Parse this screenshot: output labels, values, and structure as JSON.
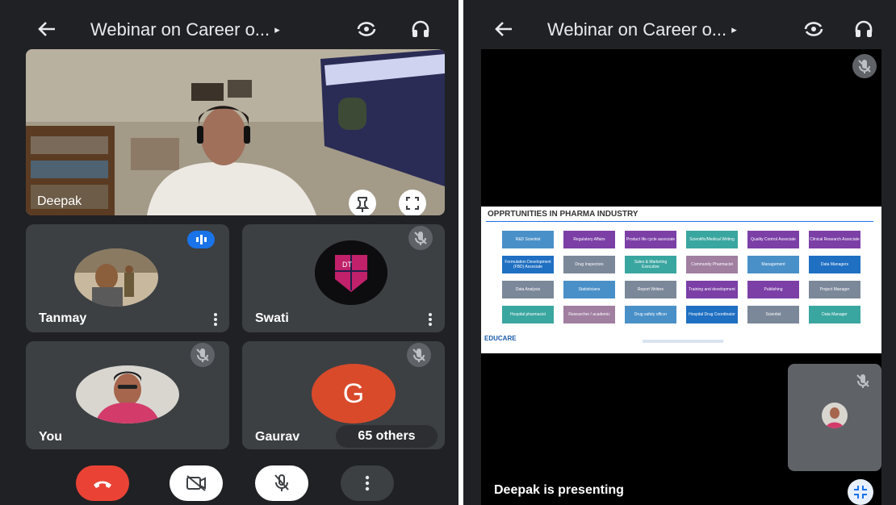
{
  "left": {
    "header": {
      "title": "Webinar on Career o...",
      "arrow": "▸"
    },
    "main_speaker": {
      "name": "Deepak"
    },
    "tiles": [
      {
        "name": "Tanmay"
      },
      {
        "name": "Swati"
      },
      {
        "name": "You"
      },
      {
        "name": "Gaurav",
        "initial": "G",
        "others_label": "65 others"
      }
    ],
    "logo_text": "DT",
    "colors": {
      "end_call": "#ea4335",
      "gaurav_avatar": "#d94a2b",
      "speaking": "#1a73e8"
    }
  },
  "right": {
    "header": {
      "title": "Webinar on Career o...",
      "arrow": "▸"
    },
    "slide": {
      "heading": "OPPRTUNITIES IN PHARMA INDUSTRY",
      "brand": "EDUCARE",
      "cells": [
        {
          "label": "R&D Scientist",
          "color": "#4a90c8"
        },
        {
          "label": "Regulatory Affairs",
          "color": "#7b3fa6"
        },
        {
          "label": "Product life cycle associate",
          "color": "#7b3fa6"
        },
        {
          "label": "Scientific/Medical Writing",
          "color": "#3aa6a0"
        },
        {
          "label": "Quality Control Associate",
          "color": "#7b3fa6"
        },
        {
          "label": "Clinical Research Associate",
          "color": "#7b3fa6"
        },
        {
          "label": "Formulation Development (FBD) Associate",
          "color": "#1f6fc2"
        },
        {
          "label": "Drug Inspectors",
          "color": "#7b8899"
        },
        {
          "label": "Sales & Marketing Executive",
          "color": "#3aa6a0"
        },
        {
          "label": "Community Pharmacist",
          "color": "#a07fa0"
        },
        {
          "label": "Management",
          "color": "#4a90c8"
        },
        {
          "label": "Data Managers",
          "color": "#1f6fc2"
        },
        {
          "label": "Data Analysis",
          "color": "#7b8899"
        },
        {
          "label": "Statisticians",
          "color": "#4a90c8"
        },
        {
          "label": "Report Writers",
          "color": "#7b8899"
        },
        {
          "label": "Training and development",
          "color": "#7b3fa6"
        },
        {
          "label": "Publishing",
          "color": "#7b3fa6"
        },
        {
          "label": "Project Manager",
          "color": "#7b8899"
        },
        {
          "label": "Hospital pharmacist",
          "color": "#3aa6a0"
        },
        {
          "label": "Researcher / academic",
          "color": "#a07fa0"
        },
        {
          "label": "Drug safety officer",
          "color": "#4a90c8"
        },
        {
          "label": "Hospital Drug Coordinator",
          "color": "#1f6fc2"
        },
        {
          "label": "Scientist",
          "color": "#7b8899"
        },
        {
          "label": "Data Manager",
          "color": "#3aa6a0"
        }
      ]
    },
    "presenting_label": "Deepak is presenting"
  }
}
